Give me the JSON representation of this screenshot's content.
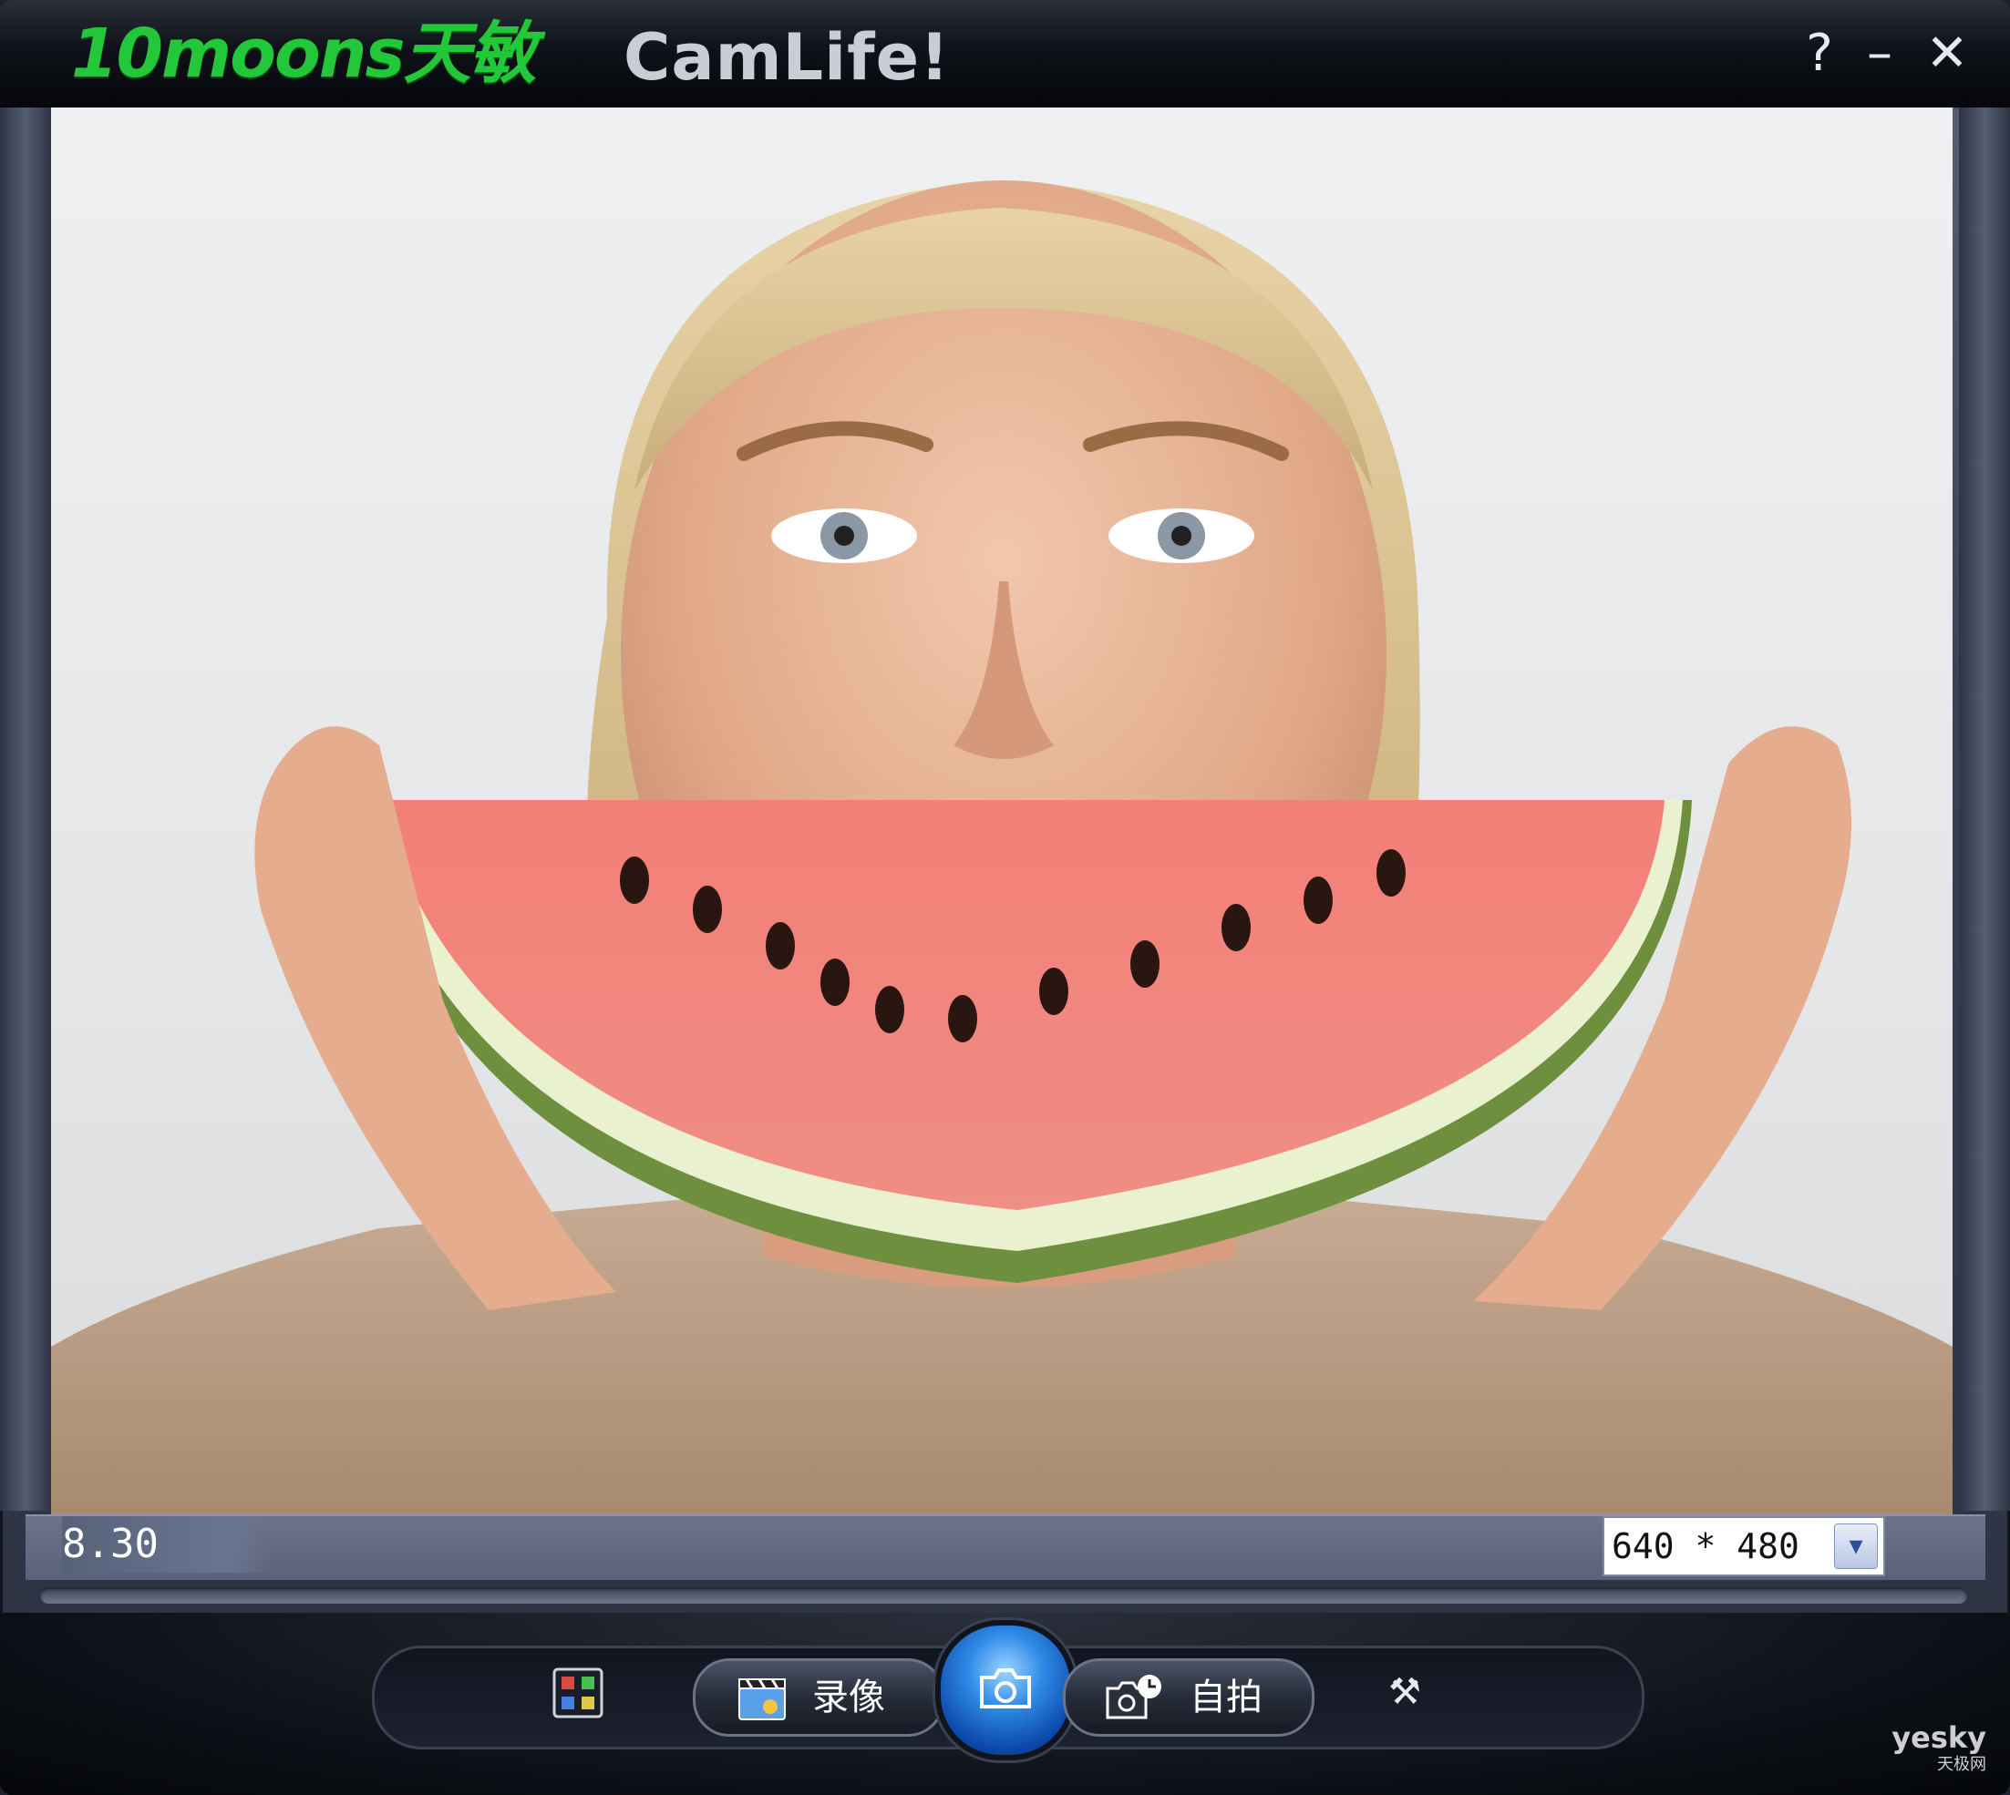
{
  "titlebar": {
    "brand": "10moons天敏",
    "app_name": "CamLife!",
    "help_label": "?",
    "minimize_label": "–",
    "close_label": "✕"
  },
  "status": {
    "fps": "8.30",
    "resolution": "640 * 480"
  },
  "controls": {
    "record_label": "录像",
    "selftimer_label": "自拍"
  },
  "watermark": {
    "line1": "yesky",
    "line2": "天极网"
  }
}
